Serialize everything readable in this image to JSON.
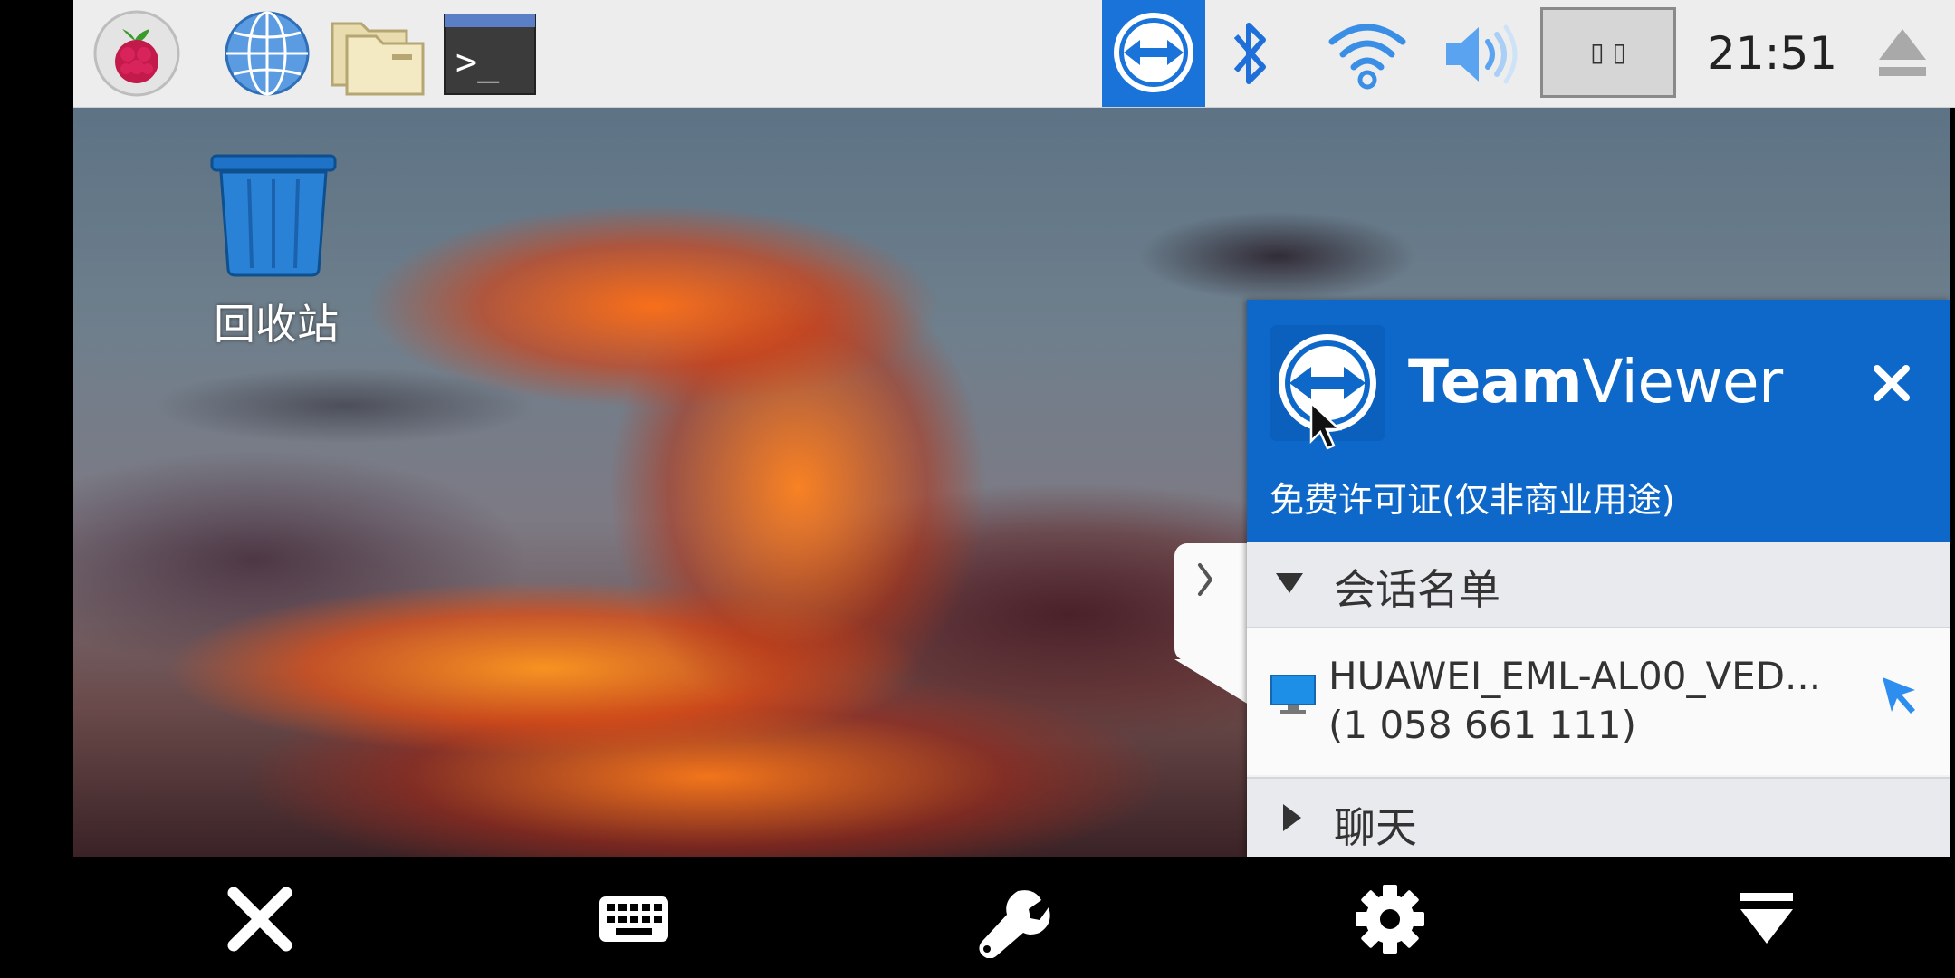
{
  "taskbar": {
    "clock": "21:51",
    "icons": [
      "raspberry-pi-menu-icon",
      "web-browser-icon",
      "file-manager-icon",
      "terminal-icon",
      "teamviewer-tray-icon",
      "bluetooth-icon",
      "wifi-icon",
      "volume-icon",
      "cpu-monitor-icon",
      "eject-icon"
    ],
    "cpu_monitor_text": "▯ ▯"
  },
  "desktop": {
    "trash_label": "回收站"
  },
  "teamviewer": {
    "title_bold": "Team",
    "title_regular": "Viewer",
    "license_text": "免费许可证(仅非商业用途)",
    "session_list_label": "会话名单",
    "session": {
      "name": "HUAWEI_EML-AL00_VED...",
      "id": "(1 058 661 111)"
    },
    "chat_label": "聊天",
    "colors": {
      "header": "#0e68c9",
      "panel": "#f1f2f3"
    }
  },
  "bottom_toolbar": {
    "buttons": [
      "close-icon",
      "keyboard-icon",
      "wrench-icon",
      "settings-gear-icon",
      "collapse-icon"
    ]
  }
}
